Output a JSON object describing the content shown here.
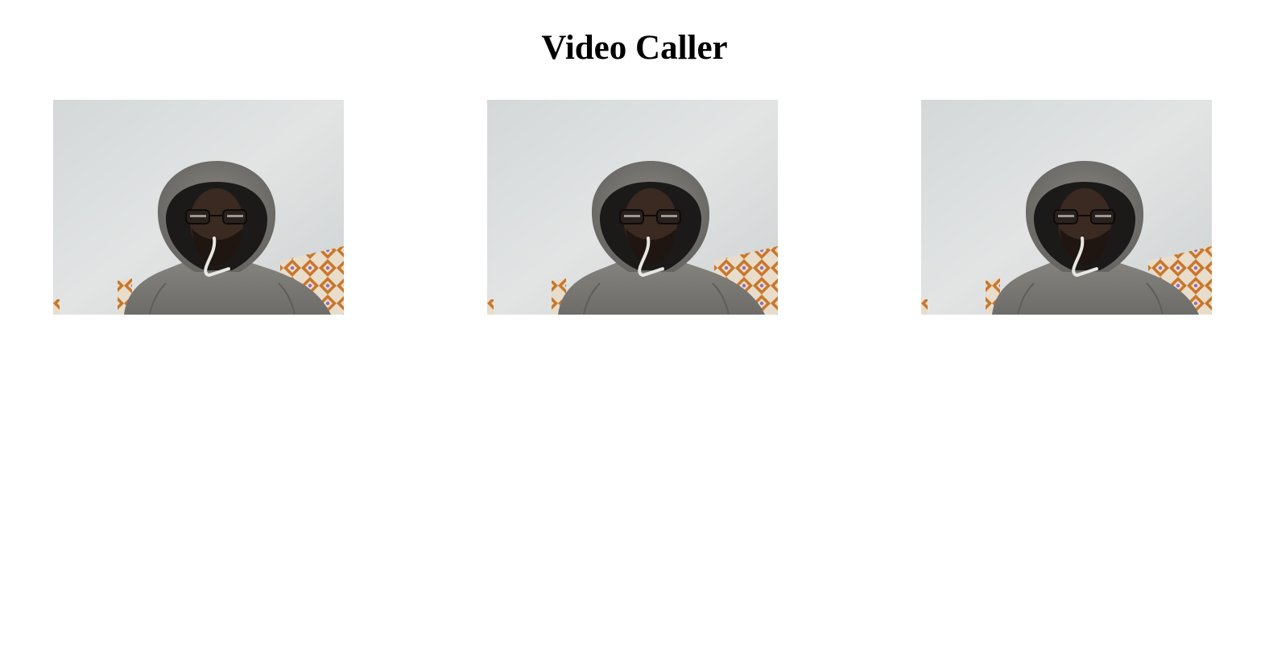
{
  "header": {
    "title": "Video Caller"
  },
  "videos": [
    {
      "stream": "webcam-feed"
    },
    {
      "stream": "webcam-feed"
    },
    {
      "stream": "webcam-feed"
    }
  ],
  "colors": {
    "wall": "#d9dcdc",
    "hoodie": "#7c7b77",
    "hood_shadow": "#1c1a18",
    "skin": "#3a2a22",
    "cushion_orange": "#c9772a",
    "cushion_cream": "#e9e1d4",
    "drawstring": "#e8e6e2"
  }
}
